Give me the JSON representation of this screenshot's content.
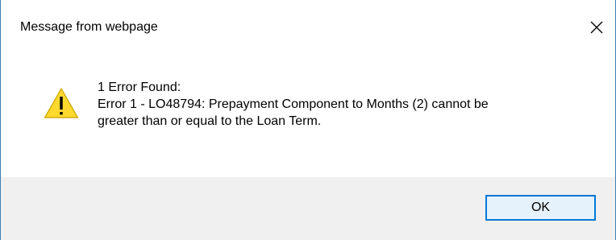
{
  "dialog": {
    "title": "Message from webpage",
    "close_icon": "close-icon",
    "warning_icon": "warning-triangle-icon",
    "message_lines": [
      "1 Error Found:",
      "Error 1 - LO48794: Prepayment Component to Months (2) cannot be",
      "greater than or equal to the Loan Term."
    ],
    "ok_label": "OK"
  },
  "colors": {
    "window_border": "#3c7fb1",
    "footer_bg": "#f0f0f0",
    "button_border": "#0078d7",
    "button_bg": "#e5f1fb",
    "warning_fill": "#ffd92e"
  }
}
